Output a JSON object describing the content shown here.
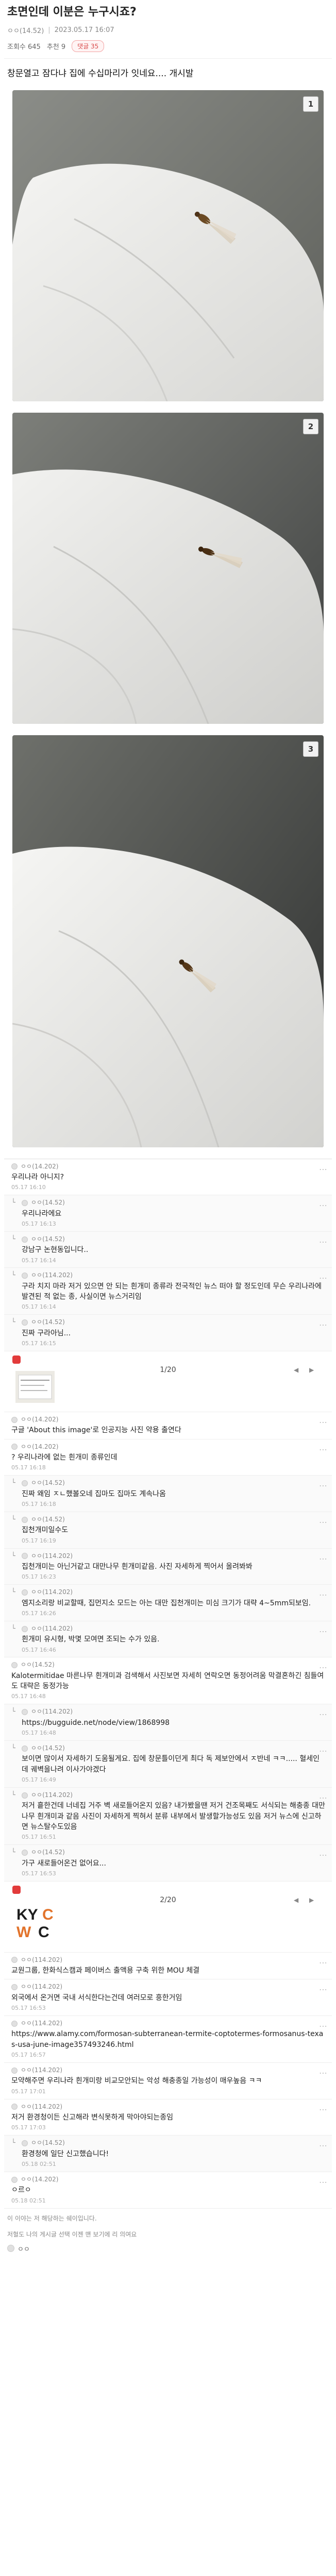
{
  "post": {
    "title": "초면인데 이분은 누구시죠?",
    "author": "ㅇㅇ(14.52)",
    "date": "2023.05.17 16:07",
    "views_label": "조회수 645",
    "likes_label": "추천 9",
    "comments_pill": "댓글 35",
    "body": "창문열고 잠다냐 집에 수십마리가 잇네요.... 개시발"
  },
  "photos": [
    {
      "num": "1"
    },
    {
      "num": "2"
    },
    {
      "num": "3"
    }
  ],
  "comments_a": [
    {
      "id": "c1",
      "reply": false,
      "author": "ㅇㅇ(14.202)",
      "text": "우리나라 아니지?",
      "time": "05.17 16:10"
    },
    {
      "id": "c2",
      "reply": true,
      "author": "ㅇㅇ(14.52)",
      "text": "우리나라에요",
      "time": "05.17 16:13"
    },
    {
      "id": "c3",
      "reply": true,
      "author": "ㅇㅇ(14.52)",
      "text": "강남구 논현동입니다..",
      "time": "05.17 16:14"
    },
    {
      "id": "c4",
      "reply": true,
      "author": "ㅇㅇ(114.202)",
      "text": "구라 치지 마라 저거 있으면 안 되는 흰개미 종류라 전국적인 뉴스 떠야 할 정도인데 무슨 우리나라에 발견된 적 없는 종, 사실이면 뉴스거리임",
      "time": "05.17 16:14"
    },
    {
      "id": "c5",
      "reply": true,
      "author": "ㅇㅇ(14.52)",
      "text": "진짜 구라아님...",
      "time": "05.17 16:15"
    }
  ],
  "image_card_1": {
    "counter": "1/20"
  },
  "comments_b": [
    {
      "id": "c6",
      "reply": false,
      "author": "ㅇㅇ(14.202)",
      "text": "구글 'About this image'로 인공지능 사진 약용 출연다",
      "time": ""
    },
    {
      "id": "c7",
      "reply": false,
      "author": "ㅇㅇ(14.202)",
      "text": "? 우리나라에 없는 흰개미 종류인데",
      "time": "05.17 16:18"
    },
    {
      "id": "c8",
      "reply": true,
      "author": "ㅇㅇ(14.52)",
      "text": "진짜 왜임 ㅈㄴ했볼오네 집마도 집마도 계속나옴",
      "time": "05.17 16:18"
    },
    {
      "id": "c9",
      "reply": true,
      "author": "ㅇㅇ(14.52)",
      "text": "집천개미일수도",
      "time": "05.17 16:19"
    },
    {
      "id": "c10",
      "reply": true,
      "author": "ㅇㅇ(114.202)",
      "text": "집천개미는 아닌거같고 대만나무 흰개미같음. 사진 자세하게 찍어서 올려봐봐",
      "time": "05.17 16:23"
    },
    {
      "id": "c11",
      "reply": true,
      "author": "ㅇㅇ(114.202)",
      "text": "엠지소리랑 비교할때, 집먼지소 모드는 아는 대만 집천개미는 미심 크기가 대략 4~5mm되보임.",
      "time": "05.17 16:26"
    },
    {
      "id": "c12",
      "reply": true,
      "author": "ㅇㅇ(114.202)",
      "text": "흰개미 유시형, 박몇 모여면 조되는 수가 있음.",
      "time": "05.17 16:46"
    },
    {
      "id": "c13",
      "reply": false,
      "author": "ㅇㅇ(14.52)",
      "text": "Kalotermitidae 마른나무 흰개미과 검색해서 사진보면 자세히 연락오면 동정어려움 막결혼하긴 침들여도 대략은 동정가능",
      "time": "05.17 16:48"
    },
    {
      "id": "c14",
      "reply": true,
      "author": "ㅇㅇ(114.202)",
      "text": "https://bugguide.net/node/view/1868998",
      "time": "05.17 16:48"
    },
    {
      "id": "c15",
      "reply": true,
      "author": "ㅇㅇ(14.52)",
      "text": "보이면 많이서 자세하기 도움될게요. 집에 창문틀이던게 최다 독 제보안에서 ㅈ반네 ㅋㅋ..... 혈세인데 궤벽을나려 이사가야겠다",
      "time": "05.17 16:49"
    },
    {
      "id": "c16",
      "reply": true,
      "author": "ㅇㅇ(114.202)",
      "text": "저거 흩한건데 너네집 거주 벽 새로들어온지 있음? 내가봤을땐 저거 건조목째도 서식되는 해충종 대만나무 흰개미과 같음 사진이 자세하게 찍혀서 분류 내부에서 발생할가능성도 있음 저거 뉴스에 신고하면 뉴스탈수도있음",
      "time": "05.17 16:51"
    },
    {
      "id": "c17",
      "reply": true,
      "author": "ㅇㅇ(14.52)",
      "text": "가구 새로들어온건 없어요...",
      "time": "05.17 16:53"
    }
  ],
  "image_card_2": {
    "counter": "2/20",
    "logo_text": "KYCWC"
  },
  "comments_c": [
    {
      "id": "c18",
      "reply": false,
      "author": "ㅇㅇ(114.202)",
      "text": "교원그룹, 한화식스캠과 페이버스 출액용 구축 위한 MOU 체결",
      "time": ""
    },
    {
      "id": "c19",
      "reply": false,
      "author": "ㅇㅇ(114.202)",
      "text": "외국에서 온거면 국내 서식한다는건데 여러모로 흥한거임",
      "time": "05.17 16:53"
    },
    {
      "id": "c20",
      "reply": false,
      "author": "ㅇㅇ(114.202)",
      "text": "https://www.alamy.com/formosan-subterranean-termite-coptotermes-formosanus-texas-usa-june-image357493246.html",
      "time": "05.17 16:57"
    },
    {
      "id": "c21",
      "reply": false,
      "author": "ㅇㅇ(114.202)",
      "text": "모약해주면 우리나라 흰개미랑 비교모안되는 악성 해충종일 가능성이 매우높음 ㅋㅋ",
      "time": "05.17 17:01"
    },
    {
      "id": "c22",
      "reply": false,
      "author": "ㅇㅇ(114.202)",
      "text": "저거 환경청이든 신고해라 변식못하게 막아야되는종임",
      "time": "05.17 17:03"
    },
    {
      "id": "c23",
      "reply": true,
      "author": "ㅇㅇ(14.52)",
      "text": "환경청에 일단 신고했습니다!",
      "time": "05.18 02:51"
    },
    {
      "id": "c24",
      "reply": false,
      "author": "ㅇㅇ(14.202)",
      "text": "ㅇ르ㅇ",
      "time": "05.18 02:51"
    }
  ],
  "footer": {
    "note": "이 이야는 저 해당하는 쉐이입니다.",
    "note2": "저혈도 나의 게시글 선택 이젠  맨  보기에 리 의여요",
    "author": "ㅇㅇ"
  },
  "colors": {
    "accent_red": "#e23b3b",
    "pill_red": "#d84a4a"
  }
}
